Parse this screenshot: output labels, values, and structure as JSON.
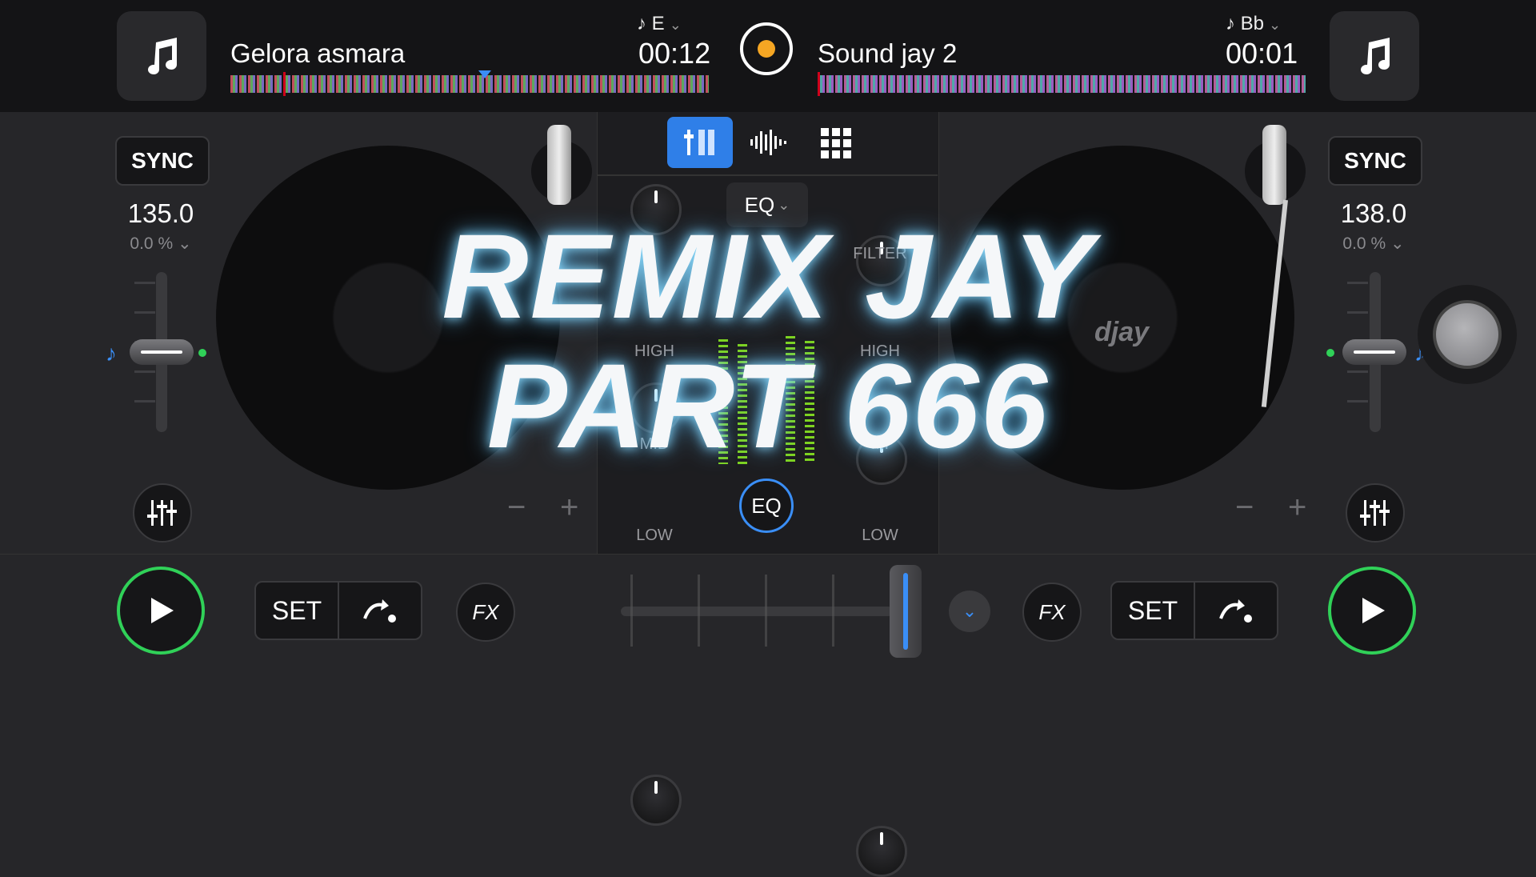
{
  "deck_left": {
    "track_title": "Gelora asmara",
    "key": "E",
    "time": "00:12",
    "sync_label": "SYNC",
    "bpm": "135.0",
    "pitch_percent": "0.0 %",
    "set_label": "SET",
    "fx_label": "FX"
  },
  "deck_right": {
    "track_title": "Sound jay 2",
    "key": "Bb",
    "time": "00:01",
    "sync_label": "SYNC",
    "bpm": "138.0",
    "pitch_percent": "0.0 %",
    "set_label": "SET",
    "fx_label": "FX"
  },
  "mixer": {
    "eq_dropdown": "EQ",
    "eq_button": "EQ",
    "labels": {
      "filter": "FILTER",
      "high_left": "HIGH",
      "high_right": "HIGH",
      "mid_left": "MID",
      "mid_right": "MI",
      "low_left": "LOW",
      "low_right": "LOW"
    }
  },
  "platter_logo": "djay",
  "overlay": {
    "line1": "REMIX JAY",
    "line2": "PART 666"
  },
  "colors": {
    "accent_blue": "#3a8ef6",
    "play_green": "#30d158",
    "background": "#262629"
  },
  "icons": [
    "music-note-icon",
    "record-icon",
    "mixer-view-icon",
    "waveform-view-icon",
    "pads-grid-icon",
    "play-icon",
    "loop-icon",
    "eq-settings-icon"
  ]
}
